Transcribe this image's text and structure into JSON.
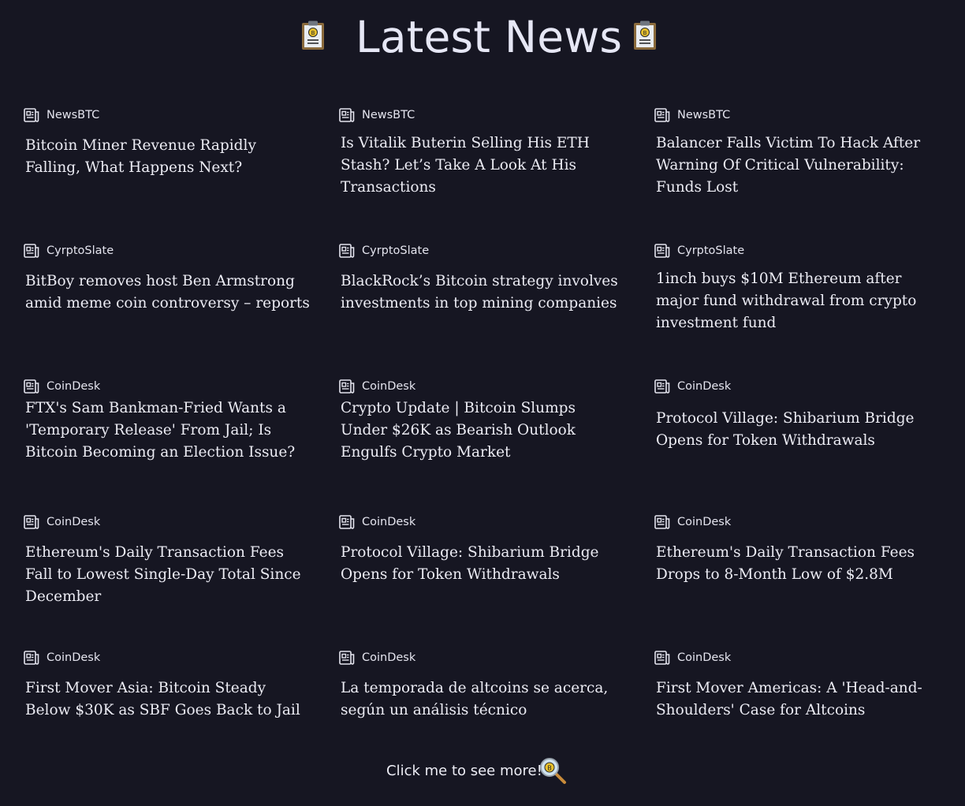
{
  "header": {
    "title": "Latest News",
    "left_icon": "clipboard-bitcoin-icon",
    "right_icon": "clipboard-bitcoin-icon"
  },
  "icons": {
    "source": "newspaper-icon",
    "see_more": "magnifier-bitcoin-icon"
  },
  "colors": {
    "background": "#161622",
    "text": "#e8e8f0",
    "clipboard_board": "#8a6a3c",
    "clipboard_coin": "#e7c02b"
  },
  "news": [
    {
      "source": "NewsBTC",
      "headline": "Bitcoin Miner Revenue Rapidly Falling, What Happens Next?"
    },
    {
      "source": "NewsBTC",
      "headline": "Is Vitalik Buterin Selling His ETH Stash? Let’s Take A Look At His Transactions"
    },
    {
      "source": "NewsBTC",
      "headline": "Balancer Falls Victim To Hack After Warning Of Critical Vulnerability: Funds Lost"
    },
    {
      "source": "CyrptoSlate",
      "headline": "BitBoy removes host Ben Armstrong amid meme coin controversy – reports"
    },
    {
      "source": "CyrptoSlate",
      "headline": "BlackRock’s Bitcoin strategy involves investments in top mining companies"
    },
    {
      "source": "CyrptoSlate",
      "headline": "1inch buys $10M Ethereum after major fund withdrawal from crypto investment fund"
    },
    {
      "source": "CoinDesk",
      "headline": "FTX's Sam Bankman-Fried Wants a 'Temporary Release' From Jail; Is Bitcoin Becoming an Election Issue?"
    },
    {
      "source": "CoinDesk",
      "headline": "Crypto Update | Bitcoin Slumps Under $26K as Bearish Outlook Engulfs Crypto Market"
    },
    {
      "source": "CoinDesk",
      "headline": "Protocol Village: Shibarium Bridge Opens for Token Withdrawals"
    },
    {
      "source": "CoinDesk",
      "headline": "Ethereum's Daily Transaction Fees Fall to Lowest Single-Day Total Since December"
    },
    {
      "source": "CoinDesk",
      "headline": "Protocol Village: Shibarium Bridge Opens for Token Withdrawals"
    },
    {
      "source": "CoinDesk",
      "headline": "Ethereum's Daily Transaction Fees Drops to 8-Month Low of $2.8M"
    },
    {
      "source": "CoinDesk",
      "headline": "First Mover Asia: Bitcoin Steady Below $30K as SBF Goes Back to Jail"
    },
    {
      "source": "CoinDesk",
      "headline": "La temporada de altcoins se acerca, según un análisis técnico"
    },
    {
      "source": "CoinDesk",
      "headline": "First Mover Americas: A 'Head-and-Shoulders' Case for Altcoins"
    }
  ],
  "footer": {
    "see_more_label": "Click me to see more!"
  }
}
